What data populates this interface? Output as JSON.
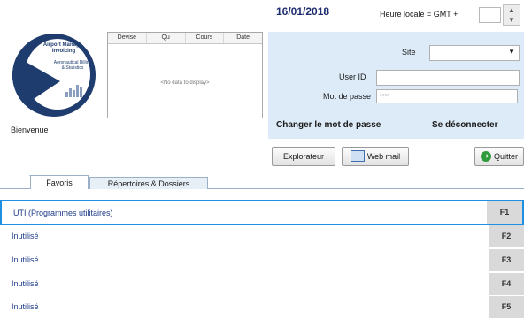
{
  "header": {
    "date": "16/01/2018",
    "timezone_label": "Heure locale = GMT +",
    "timezone_value": "",
    "spin_icon": "spinner-updown-icon"
  },
  "logo": {
    "line1": "Airport Manager Invoicing",
    "line2": "Aeronautical Billing & Statistics",
    "line3": ""
  },
  "welcome": "Bienvenue",
  "currency_table": {
    "columns": [
      "Devise",
      "Qu",
      "Cours",
      "Date"
    ],
    "empty_text": "<No data to display>"
  },
  "login": {
    "site_label": "Site",
    "site_value": "",
    "userid_label": "User ID",
    "userid_value": "",
    "password_label": "Mot de passe",
    "password_value": "****",
    "change_password": "Changer le mot de passe",
    "logout": "Se déconnecter"
  },
  "buttons": {
    "explorer": "Explorateur",
    "webmail": "Web mail",
    "quit": "Quitter"
  },
  "tabs": [
    {
      "label": "Favoris",
      "active": true
    },
    {
      "label": "Répertoires & Dossiers",
      "active": false
    }
  ],
  "function_keys": [
    {
      "label": "UTI (Programmes utilitaires)",
      "key": "F1",
      "selected": true
    },
    {
      "label": "Inutilisé",
      "key": "F2"
    },
    {
      "label": "Inutilisé",
      "key": "F3"
    },
    {
      "label": "Inutilisé",
      "key": "F4"
    },
    {
      "label": "Inutilisé",
      "key": "F5"
    }
  ],
  "colors": {
    "accent_blue": "#1e8fe1",
    "login_panel_bg": "#dcebf7",
    "brand_navy": "#1f3c6e"
  }
}
